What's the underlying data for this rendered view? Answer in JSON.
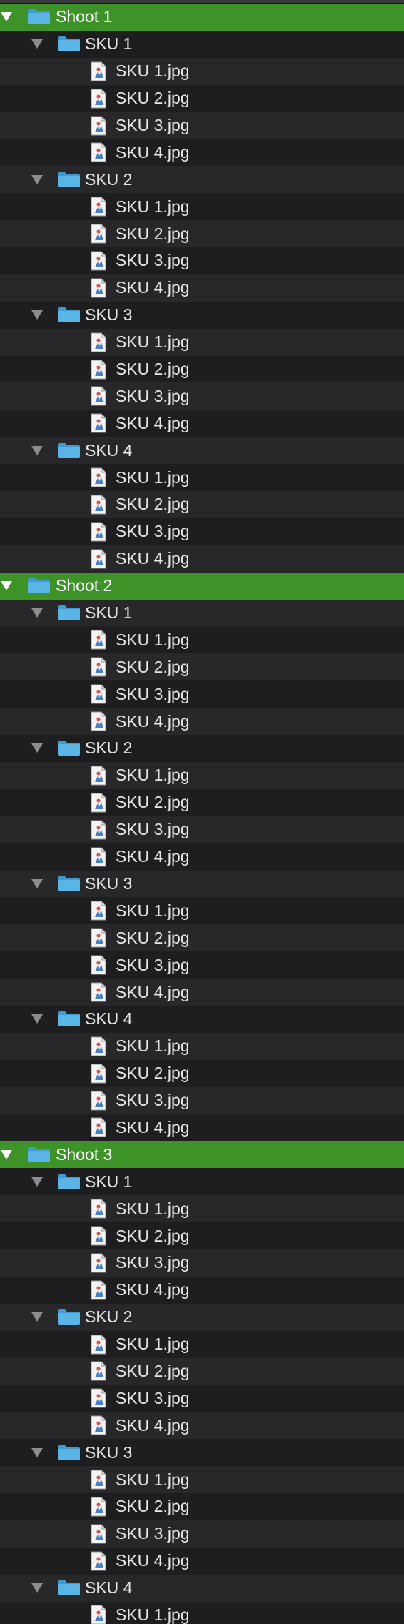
{
  "tree": [
    {
      "label": "Shoot 1",
      "children": [
        {
          "label": "SKU 1",
          "files": [
            "SKU 1.jpg",
            "SKU 2.jpg",
            "SKU 3.jpg",
            "SKU 4.jpg"
          ]
        },
        {
          "label": "SKU 2",
          "files": [
            "SKU 1.jpg",
            "SKU 2.jpg",
            "SKU 3.jpg",
            "SKU 4.jpg"
          ]
        },
        {
          "label": "SKU 3",
          "files": [
            "SKU 1.jpg",
            "SKU 2.jpg",
            "SKU 3.jpg",
            "SKU 4.jpg"
          ]
        },
        {
          "label": "SKU 4",
          "files": [
            "SKU 1.jpg",
            "SKU 2.jpg",
            "SKU 3.jpg",
            "SKU 4.jpg"
          ]
        }
      ]
    },
    {
      "label": "Shoot 2",
      "children": [
        {
          "label": "SKU 1",
          "files": [
            "SKU 1.jpg",
            "SKU 2.jpg",
            "SKU 3.jpg",
            "SKU 4.jpg"
          ]
        },
        {
          "label": "SKU 2",
          "files": [
            "SKU 1.jpg",
            "SKU 2.jpg",
            "SKU 3.jpg",
            "SKU 4.jpg"
          ]
        },
        {
          "label": "SKU 3",
          "files": [
            "SKU 1.jpg",
            "SKU 2.jpg",
            "SKU 3.jpg",
            "SKU 4.jpg"
          ]
        },
        {
          "label": "SKU 4",
          "files": [
            "SKU 1.jpg",
            "SKU 2.jpg",
            "SKU 3.jpg",
            "SKU 4.jpg"
          ]
        }
      ]
    },
    {
      "label": "Shoot 3",
      "children": [
        {
          "label": "SKU 1",
          "files": [
            "SKU 1.jpg",
            "SKU 2.jpg",
            "SKU 3.jpg",
            "SKU 4.jpg"
          ]
        },
        {
          "label": "SKU 2",
          "files": [
            "SKU 1.jpg",
            "SKU 2.jpg",
            "SKU 3.jpg",
            "SKU 4.jpg"
          ]
        },
        {
          "label": "SKU 3",
          "files": [
            "SKU 1.jpg",
            "SKU 2.jpg",
            "SKU 3.jpg",
            "SKU 4.jpg"
          ]
        },
        {
          "label": "SKU 4",
          "files": [
            "SKU 1.jpg"
          ]
        }
      ]
    }
  ],
  "colors": {
    "selected_row": "#3d9327",
    "row_alt": "#28282b",
    "row_base": "#1e1e20",
    "folder_blue": "#5ab4e5"
  },
  "icons": {
    "shoot": "folder-icon",
    "sku": "folder-icon",
    "file": "jpeg-file-icon",
    "expand": "disclosure-triangle-expanded-icon"
  }
}
